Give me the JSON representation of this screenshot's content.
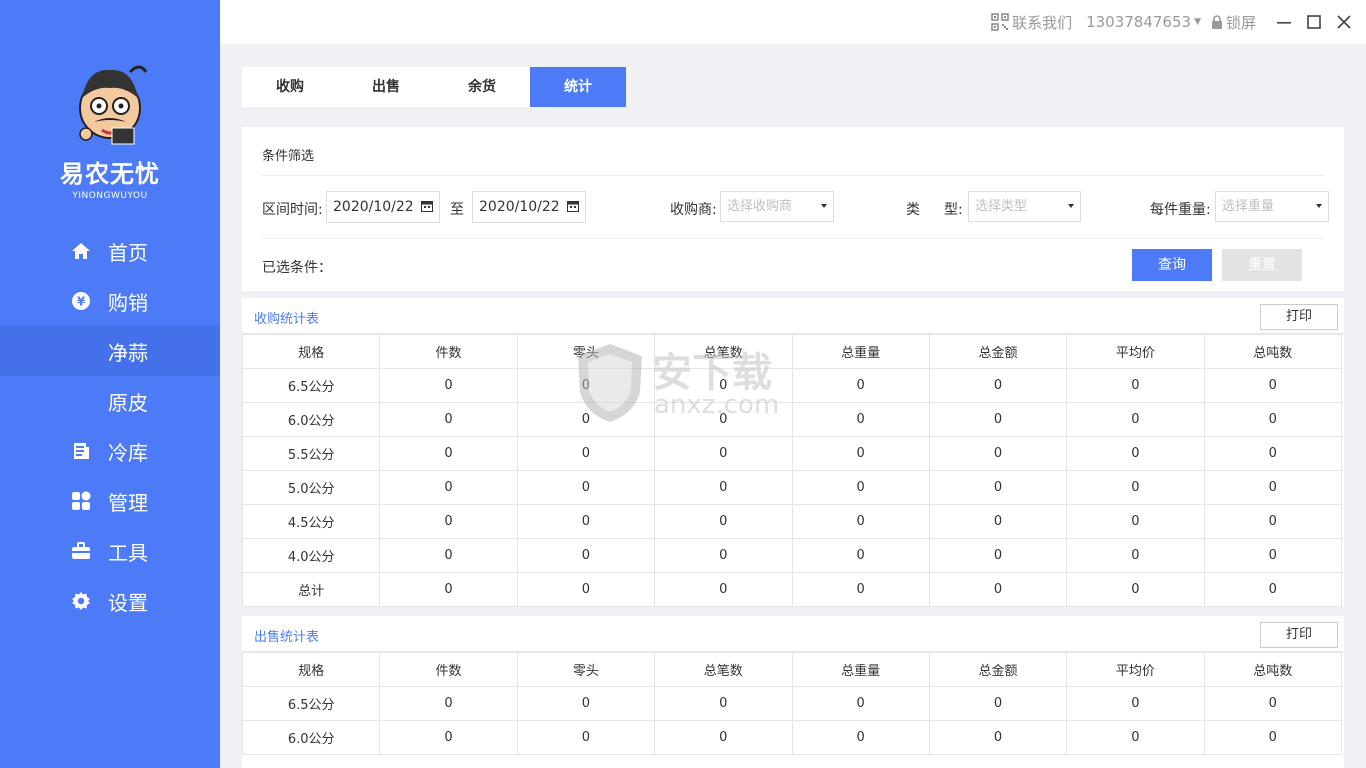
{
  "brand": {
    "name": "易农无忧",
    "subtitle": "YINONGWUYOU"
  },
  "titlebar": {
    "contact_label": "联系我们",
    "phone": "13037847653",
    "lock_label": "锁屏"
  },
  "nav": {
    "home": "首页",
    "trade": "购销",
    "garlic": "净蒜",
    "skin": "原皮",
    "cold": "冷库",
    "manage": "管理",
    "tools": "工具",
    "settings": "设置"
  },
  "tabs": [
    "收购",
    "出售",
    "余货",
    "统计"
  ],
  "filter": {
    "title": "条件筛选",
    "range_label": "区间时间:",
    "start_date": "2020/10/22",
    "to": "至",
    "end_date": "2020/10/22",
    "buyer_label": "收购商:",
    "buyer_placeholder": "选择收购商",
    "type_label_a": "类",
    "type_label_b": "型:",
    "type_placeholder": "选择类型",
    "weight_label": "每件重量:",
    "weight_placeholder": "选择重量",
    "selected_label": "已选条件：",
    "query_btn": "查询",
    "reset_btn": "重置"
  },
  "purchase_table": {
    "title": "收购统计表",
    "print": "打印",
    "headers": [
      "规格",
      "件数",
      "零头",
      "总笔数",
      "总重量",
      "总金额",
      "平均价",
      "总吨数"
    ],
    "rows": [
      [
        "6.5公分",
        "0",
        "0",
        "0",
        "0",
        "0",
        "0",
        "0"
      ],
      [
        "6.0公分",
        "0",
        "0",
        "0",
        "0",
        "0",
        "0",
        "0"
      ],
      [
        "5.5公分",
        "0",
        "0",
        "0",
        "0",
        "0",
        "0",
        "0"
      ],
      [
        "5.0公分",
        "0",
        "0",
        "0",
        "0",
        "0",
        "0",
        "0"
      ],
      [
        "4.5公分",
        "0",
        "0",
        "0",
        "0",
        "0",
        "0",
        "0"
      ],
      [
        "4.0公分",
        "0",
        "0",
        "0",
        "0",
        "0",
        "0",
        "0"
      ],
      [
        "总计",
        "0",
        "0",
        "0",
        "0",
        "0",
        "0",
        "0"
      ]
    ]
  },
  "sales_table": {
    "title": "出售统计表",
    "print": "打印",
    "headers": [
      "规格",
      "件数",
      "零头",
      "总笔数",
      "总重量",
      "总金额",
      "平均价",
      "总吨数"
    ],
    "rows": [
      [
        "6.5公分",
        "0",
        "0",
        "0",
        "0",
        "0",
        "0",
        "0"
      ],
      [
        "6.0公分",
        "0",
        "0",
        "0",
        "0",
        "0",
        "0",
        "0"
      ]
    ]
  },
  "watermark": {
    "text_cn": "安下载",
    "text_en": "anxz.com"
  },
  "colors": {
    "primary": "#4d7bf7",
    "sidebar_active": "#4471ea"
  }
}
